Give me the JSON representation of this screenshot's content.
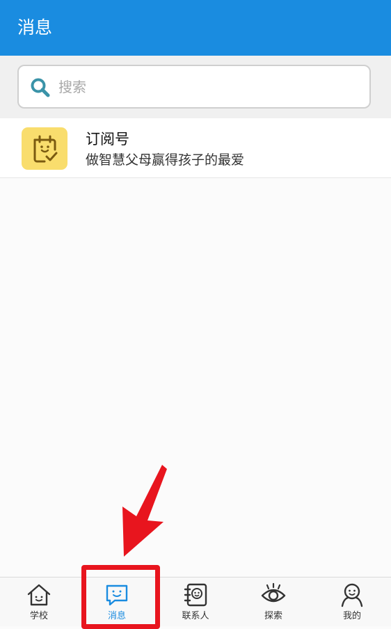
{
  "header": {
    "title": "消息"
  },
  "search": {
    "placeholder": "搜索",
    "icon": "search-icon"
  },
  "messages": [
    {
      "title": "订阅号",
      "subtitle": "做智慧父母赢得孩子的最爱",
      "icon": "subscription-icon",
      "icon_bg": "#f9dd6d"
    }
  ],
  "tabbar": {
    "active_index": 1,
    "tabs": [
      {
        "label": "学校",
        "icon": "school-house-icon"
      },
      {
        "label": "消息",
        "icon": "message-bubble-icon"
      },
      {
        "label": "联系人",
        "icon": "contacts-icon"
      },
      {
        "label": "探索",
        "icon": "eye-icon"
      },
      {
        "label": "我的",
        "icon": "profile-icon"
      }
    ]
  },
  "colors": {
    "accent": "#1a8ce0",
    "annotation": "#e8151e"
  }
}
